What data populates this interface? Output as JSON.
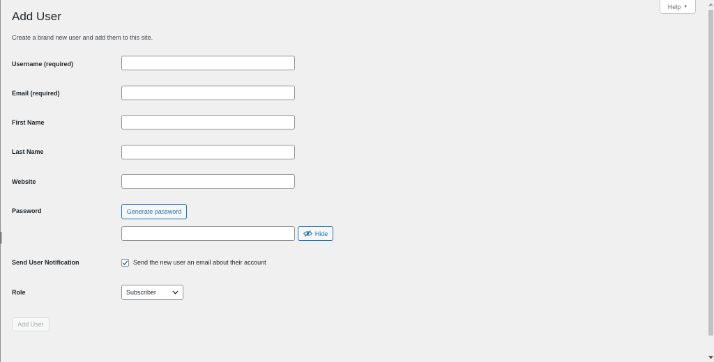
{
  "header": {
    "title": "Add User",
    "description": "Create a brand new user and add them to this site.",
    "help_label": "Help"
  },
  "form": {
    "username": {
      "label": "Username",
      "required": "(required)",
      "value": ""
    },
    "email": {
      "label": "Email",
      "required": "(required)",
      "value": ""
    },
    "first_name": {
      "label": "First Name",
      "value": ""
    },
    "last_name": {
      "label": "Last Name",
      "value": ""
    },
    "website": {
      "label": "Website",
      "value": ""
    },
    "password": {
      "label": "Password",
      "generate_label": "Generate password",
      "value": "",
      "hide_label": "Hide"
    },
    "notification": {
      "label": "Send User Notification",
      "checkbox_label": "Send the new user an email about their account",
      "checked": true
    },
    "role": {
      "label": "Role",
      "selected": "Subscriber"
    },
    "submit_label": "Add User"
  },
  "colors": {
    "accent": "#2271b1",
    "background": "#f0f0f1",
    "text": "#1d2327",
    "disabled_text": "#a7aaad"
  },
  "icons": {
    "help_caret": "caret-down-icon",
    "hide": "eye-slash-icon",
    "checkbox": "checkmark-icon",
    "select": "chevron-down-icon"
  }
}
